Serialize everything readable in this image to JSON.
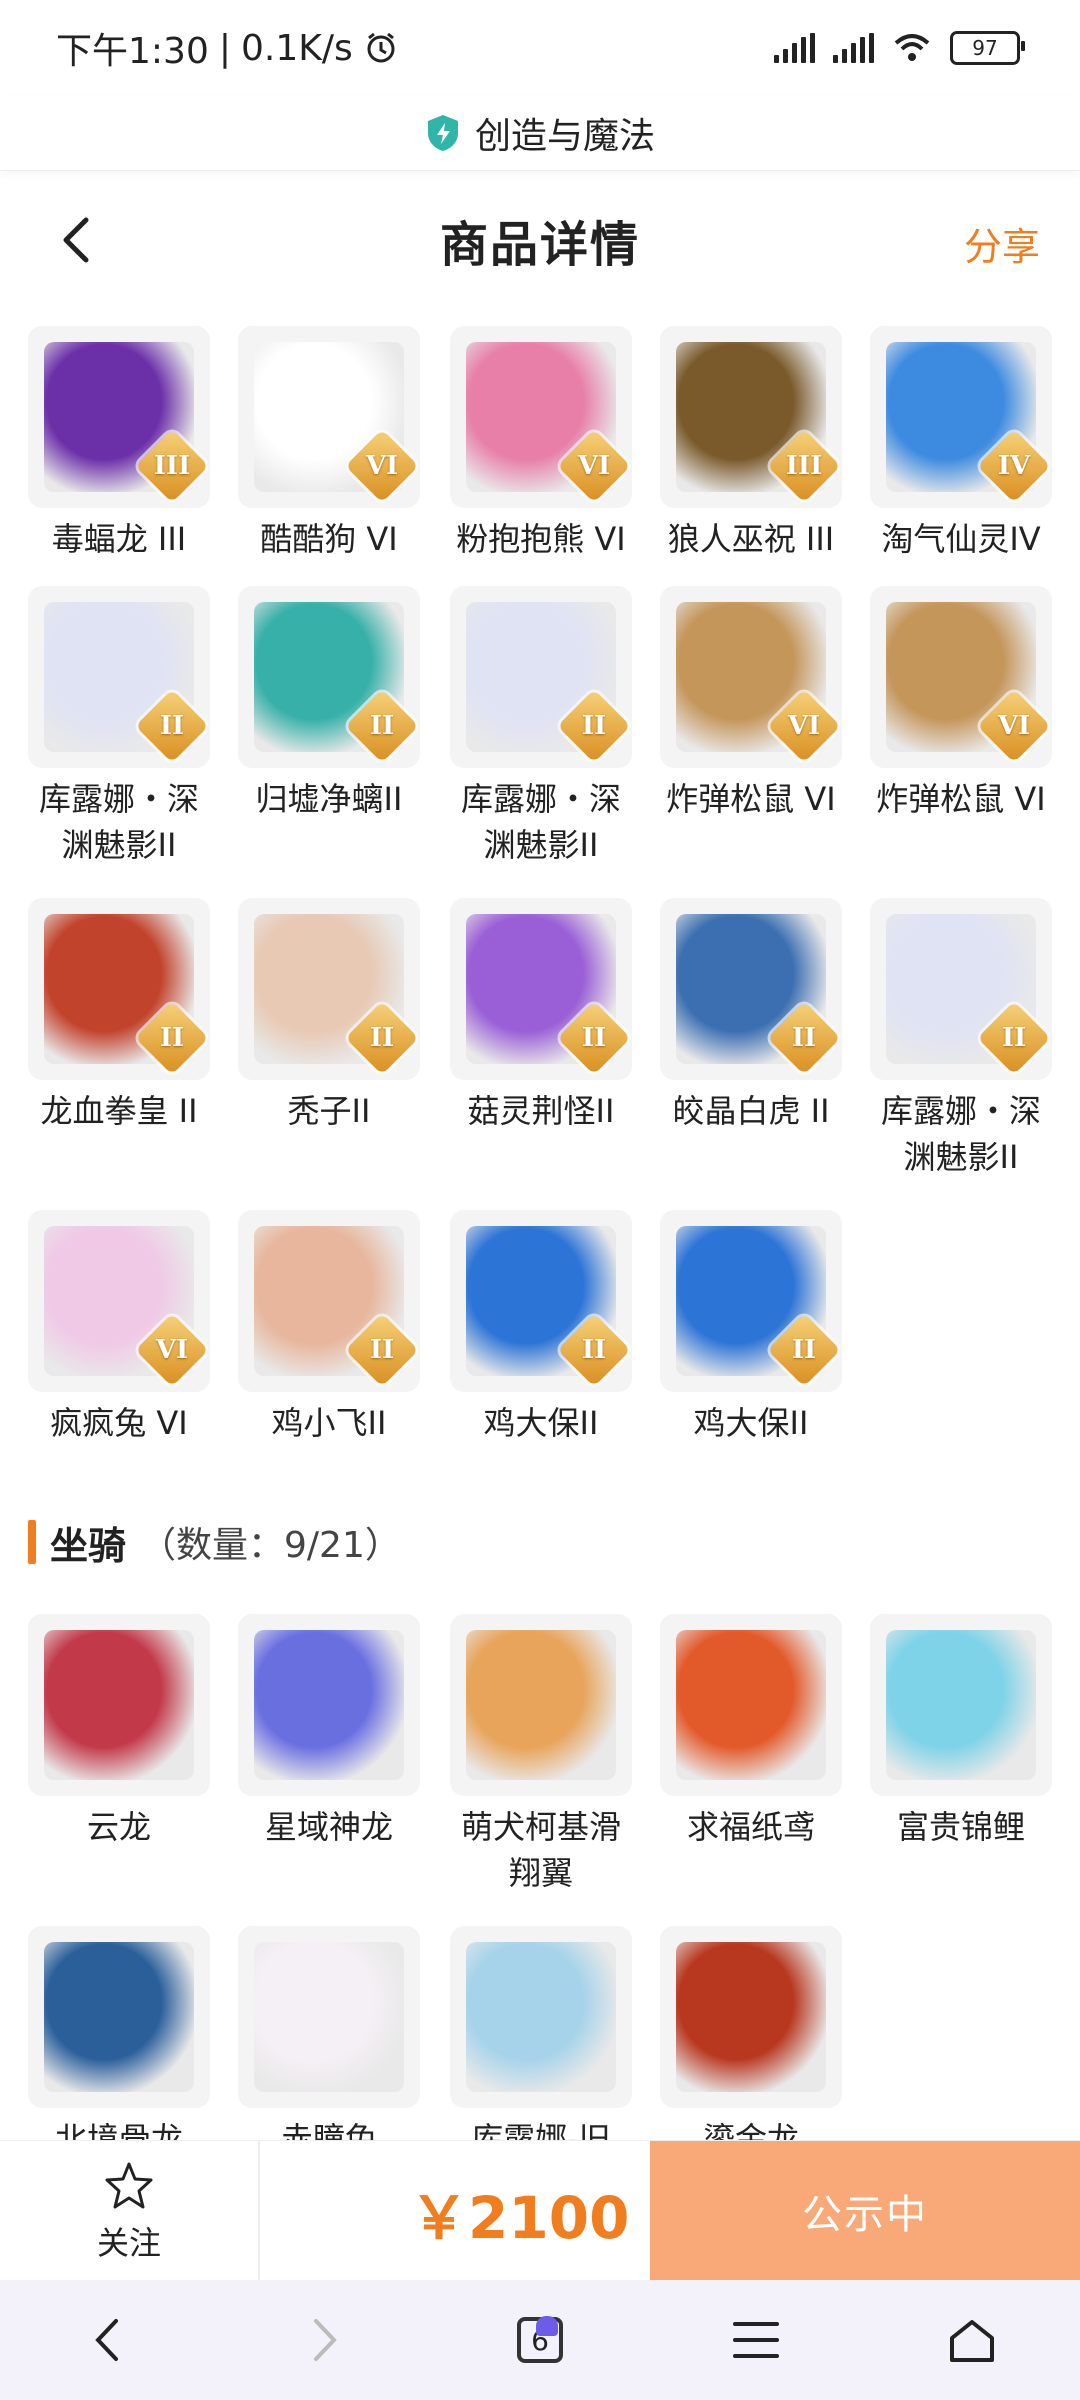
{
  "status_bar": {
    "time": "下午1:30",
    "speed": "0.1K/s",
    "battery": "97"
  },
  "site": {
    "name": "创造与魔法"
  },
  "header": {
    "title": "商品详情",
    "share": "分享"
  },
  "pets": [
    {
      "name": "毒蝠龙 III",
      "grade": "III",
      "color": "#6b2fa8"
    },
    {
      "name": "酷酷狗 VI",
      "grade": "VI",
      "color": "#ffffff"
    },
    {
      "name": "粉抱抱熊 VI",
      "grade": "VI",
      "color": "#e77fa8"
    },
    {
      "name": "狼人巫祝 III",
      "grade": "III",
      "color": "#7a5a2b"
    },
    {
      "name": "淘气仙灵IV",
      "grade": "IV",
      "color": "#3d8be0"
    },
    {
      "name": "库露娜・深渊魅影II",
      "grade": "II",
      "color": "#dfe3f4"
    },
    {
      "name": "归墟净螭II",
      "grade": "II",
      "color": "#36b0a9"
    },
    {
      "name": "库露娜・深渊魅影II",
      "grade": "II",
      "color": "#dfe3f4"
    },
    {
      "name": "炸弹松鼠 VI",
      "grade": "VI",
      "color": "#c4965a"
    },
    {
      "name": "炸弹松鼠 VI",
      "grade": "VI",
      "color": "#c4965a"
    },
    {
      "name": "龙血拳皇 II",
      "grade": "II",
      "color": "#c2432c"
    },
    {
      "name": "秃子II",
      "grade": "II",
      "color": "#e8c9b4"
    },
    {
      "name": "菇灵荆怪II",
      "grade": "II",
      "color": "#9a5fd6"
    },
    {
      "name": "皎晶白虎 II",
      "grade": "II",
      "color": "#3b6fb1"
    },
    {
      "name": "库露娜・深渊魅影II",
      "grade": "II",
      "color": "#dfe3f4"
    },
    {
      "name": "疯疯兔 VI",
      "grade": "VI",
      "color": "#f0c9e6"
    },
    {
      "name": "鸡小飞II",
      "grade": "II",
      "color": "#e7b69c"
    },
    {
      "name": "鸡大保II",
      "grade": "II",
      "color": "#2c74d6"
    },
    {
      "name": "鸡大保II",
      "grade": "II",
      "color": "#2c74d6"
    }
  ],
  "mounts_section": {
    "label": "坐骑",
    "count": "（数量：9/21）"
  },
  "mounts": [
    {
      "name": "云龙",
      "color": "#c23a4a"
    },
    {
      "name": "星域神龙",
      "color": "#6a6fe0"
    },
    {
      "name": "萌犬柯基滑翔翼",
      "color": "#e7a45a"
    },
    {
      "name": "求福纸鸢",
      "color": "#e35a2a"
    },
    {
      "name": "富贵锦鲤",
      "color": "#7fd3e8"
    },
    {
      "name": "北境骨龙",
      "color": "#2a5f9a"
    },
    {
      "name": "赤瞳兔",
      "color": "#f5f0f5"
    },
    {
      "name": "库露娜-旧",
      "color": "#a6d3ea"
    },
    {
      "name": "鎏金龙",
      "color": "#b8381f"
    }
  ],
  "action_bar": {
    "follow": "关注",
    "price": "￥2100",
    "status": "公示中"
  },
  "nav": {
    "tab_count": "6"
  }
}
